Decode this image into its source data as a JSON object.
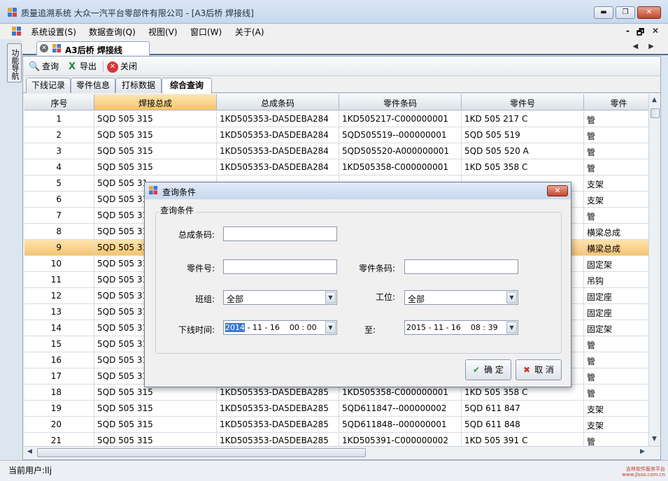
{
  "window": {
    "title": "质量追溯系统   大众一汽平台零部件有限公司 - [A3后桥 焊接线]",
    "controls": {
      "minimize": "▬",
      "restore": "❐",
      "close": "✕"
    }
  },
  "menu": {
    "items": [
      "系统设置(S)",
      "数据查询(Q)",
      "视图(V)",
      "窗口(W)",
      "关于(A)"
    ],
    "mdi_controls": {
      "minimize": "-",
      "restore": "🗗",
      "close": "✕"
    }
  },
  "sidebar_tab": "功能导航",
  "doc_tab": {
    "label": "A3后桥 焊接线",
    "close": "✕",
    "nav": "◀ ▶"
  },
  "toolbar": {
    "query": "查询",
    "export": "导出",
    "close": "关闭"
  },
  "subtabs": [
    "下线记录",
    "零件信息",
    "打标数据",
    "综合查询"
  ],
  "grid": {
    "columns": [
      "序号",
      "焊接总成",
      "总成条码",
      "零件条码",
      "零件号",
      "零件"
    ],
    "selected_row": 9,
    "rows": [
      [
        "1",
        "5QD 505 315",
        "1KD505353-DA5DEBA284",
        "1KD505217-C000000001",
        "1KD 505 217 C",
        "管"
      ],
      [
        "2",
        "5QD 505 315",
        "1KD505353-DA5DEBA284",
        "5QD505519--000000001",
        "5QD 505 519",
        "管"
      ],
      [
        "3",
        "5QD 505 315",
        "1KD505353-DA5DEBA284",
        "5QD505520-A000000001",
        "5QD 505 520 A",
        "管"
      ],
      [
        "4",
        "5QD 505 315",
        "1KD505353-DA5DEBA284",
        "1KD505358-C000000001",
        "1KD 505 358 C",
        "管"
      ],
      [
        "5",
        "5QD 505 31",
        "",
        "",
        "",
        "支架"
      ],
      [
        "6",
        "5QD 505 31",
        "",
        "",
        "",
        "支架"
      ],
      [
        "7",
        "5QD 505 31",
        "",
        "",
        "",
        "管"
      ],
      [
        "8",
        "5QD 505 31",
        "",
        "",
        "",
        "横梁总成"
      ],
      [
        "9",
        "5QD 505 31",
        "",
        "",
        "",
        "横梁总成"
      ],
      [
        "10",
        "5QD 505 31",
        "",
        "",
        "",
        "固定架"
      ],
      [
        "11",
        "5QD 505 31",
        "",
        "",
        "",
        "吊钩"
      ],
      [
        "12",
        "5QD 505 31",
        "",
        "",
        "",
        "固定座"
      ],
      [
        "13",
        "5QD 505 31",
        "",
        "",
        "",
        "固定座"
      ],
      [
        "14",
        "5QD 505 31",
        "",
        "",
        "",
        "固定架"
      ],
      [
        "15",
        "5QD 505 31",
        "",
        "",
        "",
        "管"
      ],
      [
        "16",
        "5QD 505 31",
        "",
        "",
        "",
        "管"
      ],
      [
        "17",
        "5QD 505 31",
        "",
        "",
        "",
        "管"
      ],
      [
        "18",
        "5QD 505 315",
        "1KD505353-DA5DEBA285",
        "1KD505358-C000000001",
        "1KD 505 358 C",
        "管"
      ],
      [
        "19",
        "5QD 505 315",
        "1KD505353-DA5DEBA285",
        "5QD611847--000000002",
        "5QD 611 847",
        "支架"
      ],
      [
        "20",
        "5QD 505 315",
        "1KD505353-DA5DEBA285",
        "5QD611848--000000001",
        "5QD 611 848",
        "支架"
      ],
      [
        "21",
        "5QD 505 315",
        "1KD505353-DA5DEBA285",
        "1KD505391-C000000002",
        "1KD 505 391 C",
        "管"
      ]
    ]
  },
  "dialog": {
    "title": "查询条件",
    "group_label": "查询条件",
    "fields": {
      "assembly_barcode_label": "总成条码:",
      "part_no_label": "零件号:",
      "part_barcode_label": "零件条码:",
      "team_label": "班组:",
      "team_value": "全部",
      "station_label": "工位:",
      "station_value": "全部",
      "time_label": "下线时间:",
      "to_label": "至:",
      "from_year": "2014",
      "from_rest": " - 11 - 16    00 : 00",
      "to_value": "2015 - 11 - 16    08 : 39"
    },
    "ok": "确 定",
    "cancel": "取 消"
  },
  "status": {
    "user": "当前用户:llj",
    "watermark_line1": "吉林软件服务平台",
    "watermark_line2": "www.jlsso.com.cn"
  },
  "colors": {
    "accent": "#f8c370",
    "title_bg": "#c6d8ee",
    "close_red": "#c4452e"
  }
}
